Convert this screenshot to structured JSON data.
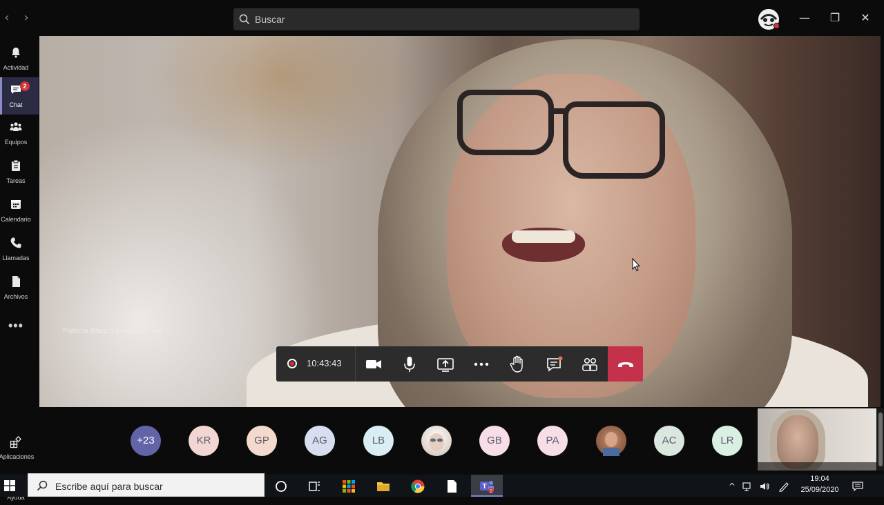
{
  "search": {
    "placeholder": "Buscar"
  },
  "rail": {
    "items": [
      {
        "label": "Actividad",
        "icon": "bell-icon"
      },
      {
        "label": "Chat",
        "icon": "chat-icon",
        "badge": "2"
      },
      {
        "label": "Equipos",
        "icon": "teams-icon"
      },
      {
        "label": "Tareas",
        "icon": "tasks-icon"
      },
      {
        "label": "Calendario",
        "icon": "calendar-icon"
      },
      {
        "label": "Llamadas",
        "icon": "phone-icon"
      },
      {
        "label": "Archivos",
        "icon": "files-icon"
      }
    ],
    "more": "•••",
    "apps_label": "Aplicaciones",
    "help_label": "Ayuda"
  },
  "video": {
    "participant_name": "Patricia Blanco (Invitado)",
    "name_more": "•••"
  },
  "call_toolbar": {
    "timer": "10:43:43"
  },
  "participants": [
    {
      "initials": "+23",
      "color": "#6264a7"
    },
    {
      "initials": "KR",
      "color": "#f2d6d3"
    },
    {
      "initials": "GP",
      "color": "#f4d9cd"
    },
    {
      "initials": "AG",
      "color": "#d8deef"
    },
    {
      "initials": "LB",
      "color": "#d8eef2"
    },
    {
      "initials": "",
      "color": "#e9e2dc"
    },
    {
      "initials": "GB",
      "color": "#f6dde6"
    },
    {
      "initials": "PA",
      "color": "#f6dde6"
    },
    {
      "initials": "",
      "color": "#9f6c4f"
    },
    {
      "initials": "AC",
      "color": "#d9e7df"
    },
    {
      "initials": "LR",
      "color": "#d9efe4"
    }
  ],
  "taskbar": {
    "search_placeholder": "Escribe aquí para buscar",
    "time": "19:04",
    "date": "25/09/2020"
  },
  "colors": {
    "accent": "#6264a7",
    "hangup": "#c4314b",
    "badge": "#d13438"
  }
}
